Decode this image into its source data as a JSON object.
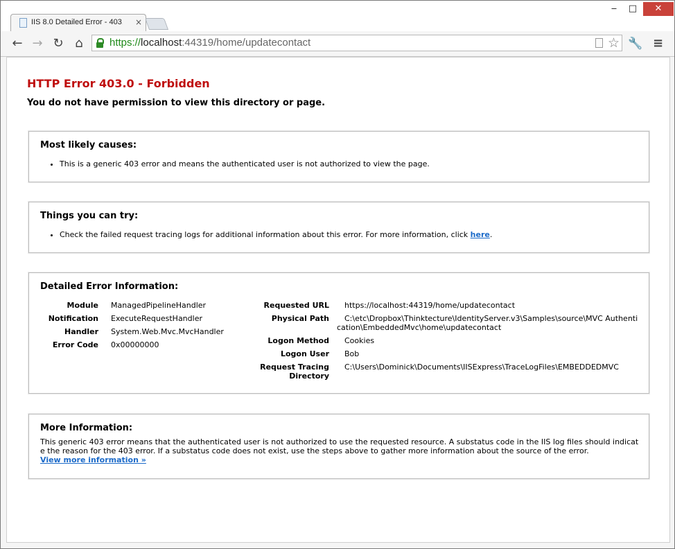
{
  "browser": {
    "tab_title": "IIS 8.0 Detailed Error - 403.",
    "tab_close": "×",
    "window_min": "‒",
    "window_max": "□",
    "window_close": "✕",
    "nav_back": "←",
    "nav_forward": "→",
    "nav_reload": "↻",
    "nav_home": "⌂",
    "url_scheme": "https://",
    "url_host": "localhost",
    "url_rest": ":44319/home/updatecontact",
    "star": "☆",
    "wrench": "🔧",
    "menu": "≡",
    "secure_color": "#2e8b27"
  },
  "page": {
    "heading": "HTTP Error 403.0 - Forbidden",
    "subheading": "You do not have permission to view this directory or page.",
    "causes": {
      "title": "Most likely causes:",
      "items": [
        "This is a generic 403 error and means the authenticated user is not authorized to view the page."
      ]
    },
    "try": {
      "title": "Things you can try:",
      "text": "Check the failed request tracing logs for additional information about this error. For more information, click ",
      "link": "here",
      "suffix": "."
    },
    "details": {
      "title": "Detailed Error Information:",
      "left": [
        {
          "label": "Module",
          "value": "ManagedPipelineHandler"
        },
        {
          "label": "Notification",
          "value": "ExecuteRequestHandler"
        },
        {
          "label": "Handler",
          "value": "System.Web.Mvc.MvcHandler"
        },
        {
          "label": "Error Code",
          "value": "0x00000000"
        }
      ],
      "right": [
        {
          "label": "Requested URL",
          "value": "https://localhost:44319/home/updatecontact"
        },
        {
          "label": "Physical Path",
          "value": "C:\\etc\\Dropbox\\Thinktecture\\IdentityServer.v3\\Samples\\source\\MVC Authentication\\EmbeddedMvc\\home\\updatecontact"
        },
        {
          "label": "Logon Method",
          "value": "Cookies"
        },
        {
          "label": "Logon User",
          "value": "Bob"
        },
        {
          "label": "Request Tracing Directory",
          "value": "C:\\Users\\Dominick\\Documents\\IISExpress\\TraceLogFiles\\EMBEDDEDMVC"
        }
      ]
    },
    "more": {
      "title": "More Information:",
      "text": "This generic 403 error means that the authenticated user is not authorized to use the requested resource. A substatus code in the IIS log files should indicate the reason for the 403 error. If a substatus code does not exist, use the steps above to gather more information about the source of the error.",
      "link": "View more information »"
    },
    "accent_red": "#bf0e0e",
    "link_blue": "#1b6ac9"
  }
}
